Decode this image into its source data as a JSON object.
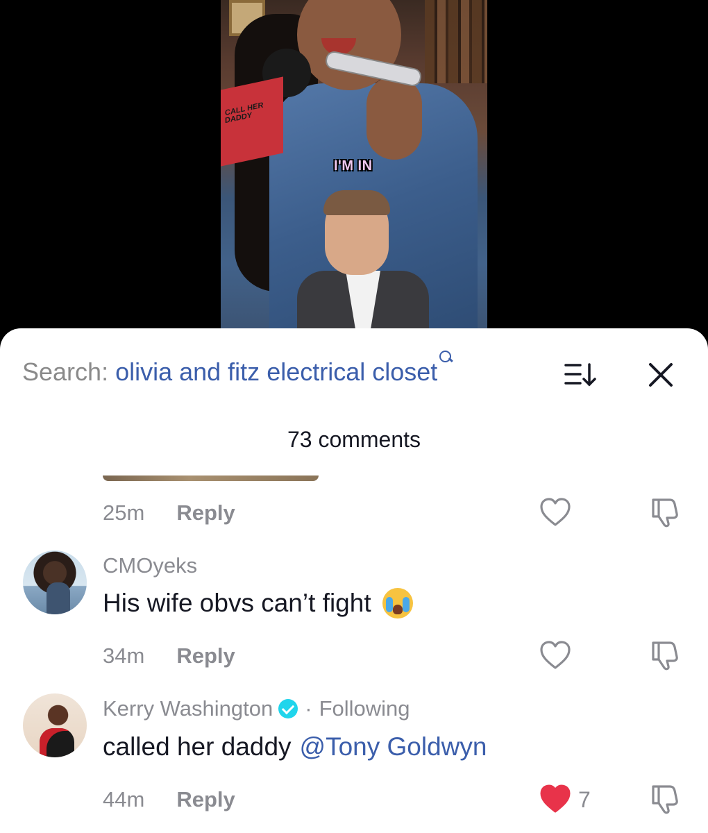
{
  "video": {
    "caption": "I'M IN",
    "mic_brand": "CALL HER DADDY"
  },
  "search": {
    "prefix": "Search:",
    "query": "olivia and fitz electrical closet"
  },
  "comments_count": "73 comments",
  "previous_comment": {
    "time": "25m",
    "reply_label": "Reply"
  },
  "comments": [
    {
      "username": "CMOyeks",
      "text": "His wife obvs can’t fight",
      "emoji": "loudly-crying-face",
      "time": "34m",
      "reply_label": "Reply",
      "liked": false
    },
    {
      "username": "Kerry Washington",
      "verified": true,
      "following_label": "Following",
      "text": "called her daddy",
      "mention": "@Tony Goldwyn",
      "time": "44m",
      "reply_label": "Reply",
      "liked": true,
      "like_count": "7"
    }
  ],
  "icons": {
    "sort": "sort-icon",
    "close": "close-icon",
    "heart": "heart-icon",
    "dislike": "thumbs-down-icon",
    "verified": "verified-badge-icon"
  },
  "colors": {
    "link_blue": "#3b5eab",
    "muted_gray": "#8a8b91",
    "like_red": "#e8334a",
    "verified_cyan": "#20d5ec"
  }
}
